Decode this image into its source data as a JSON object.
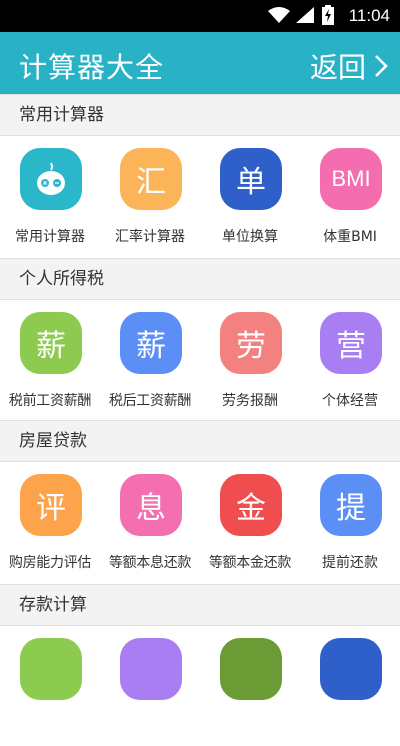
{
  "status_bar": {
    "time": "11:04"
  },
  "app_bar": {
    "title": "计算器大全",
    "back_label": "返回"
  },
  "sections": [
    {
      "header": "常用计算器",
      "items": [
        {
          "label": "常用计算器",
          "glyph": "",
          "icon": "robot-calculator-icon",
          "color": "#2ab7c9"
        },
        {
          "label": "汇率计算器",
          "glyph": "汇",
          "color": "#fbb558"
        },
        {
          "label": "单位换算",
          "glyph": "单",
          "color": "#2f5fc9"
        },
        {
          "label": "体重BMI",
          "glyph": "BMI",
          "color": "#f46dae"
        }
      ]
    },
    {
      "header": "个人所得税",
      "items": [
        {
          "label": "税前工资薪酬",
          "glyph": "薪",
          "color": "#8ccb4f"
        },
        {
          "label": "税后工资薪酬",
          "glyph": "薪",
          "color": "#5b8ff6"
        },
        {
          "label": "劳务报酬",
          "glyph": "劳",
          "color": "#f2817f"
        },
        {
          "label": "个体经营",
          "glyph": "营",
          "color": "#a97ef2"
        }
      ]
    },
    {
      "header": "房屋贷款",
      "items": [
        {
          "label": "购房能力评估",
          "glyph": "评",
          "color": "#fca34b"
        },
        {
          "label": "等额本息还款",
          "glyph": "息",
          "color": "#f46fb0"
        },
        {
          "label": "等额本金还款",
          "glyph": "金",
          "color": "#f04e4e"
        },
        {
          "label": "提前还款",
          "glyph": "提",
          "color": "#5b8ff6"
        }
      ]
    },
    {
      "header": "存款计算",
      "items": [
        {
          "label": "",
          "glyph": "",
          "color": "#8ccb4f"
        },
        {
          "label": "",
          "glyph": "",
          "color": "#a97ef2"
        },
        {
          "label": "",
          "glyph": "",
          "color": "#6a9b34"
        },
        {
          "label": "",
          "glyph": "",
          "color": "#2f5fc9"
        }
      ]
    }
  ]
}
